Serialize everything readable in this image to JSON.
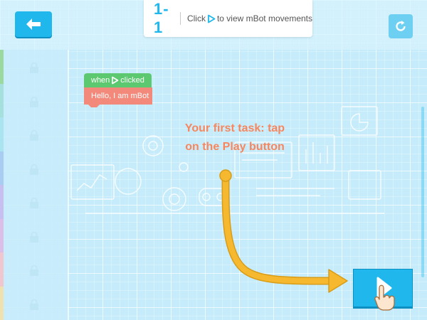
{
  "header": {
    "level": "1-1",
    "instruction_before": "Click",
    "instruction_after": "to view mBot movements"
  },
  "code_blocks": {
    "event_label_before": "when",
    "event_label_after": "clicked",
    "say_text": "Hello, I am mBot"
  },
  "task": {
    "line1": "Your first task: tap",
    "line2": "on the Play button"
  },
  "sidebar": {
    "locked_slots": 8,
    "stripe_colors": [
      "#9ad9a0",
      "#a6e0dc",
      "#a9e4f0",
      "#a9cdf2",
      "#c6bff0",
      "#dcbfe9",
      "#f0c6cf",
      "#efe2b0"
    ]
  },
  "icons": {
    "back": "back-arrow-icon",
    "reset": "refresh-icon",
    "lock": "lock-icon",
    "play": "play-icon",
    "hand": "tap-hand-icon"
  },
  "colors": {
    "accent_blue": "#1fb7ec",
    "event_green": "#5cc971",
    "say_red": "#f3897b",
    "task_orange": "#f7865e",
    "arrow_yellow": "#f5b82e"
  }
}
